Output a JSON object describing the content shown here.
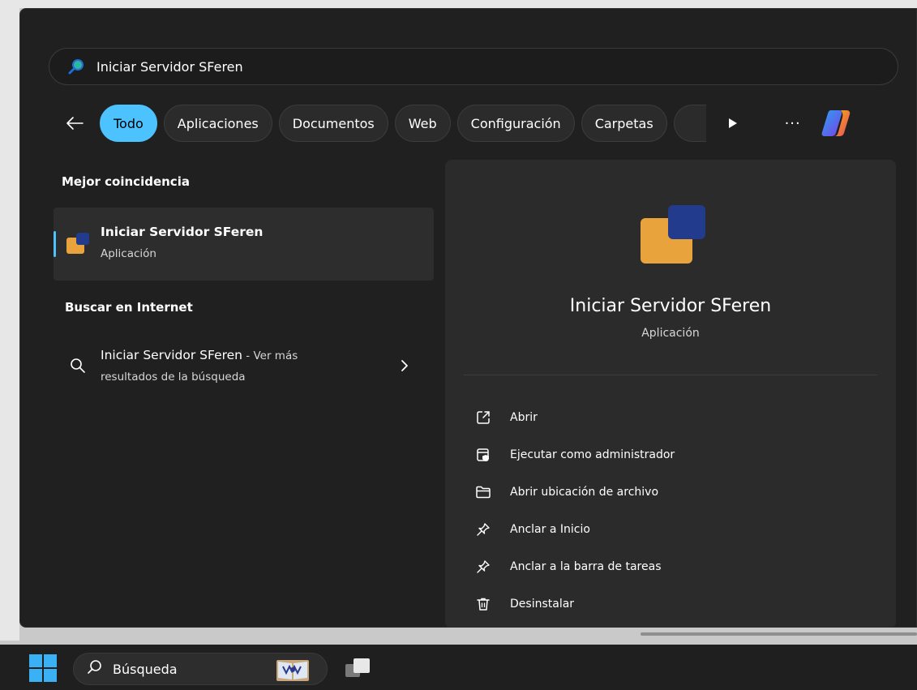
{
  "search": {
    "query": "Iniciar Servidor SFeren",
    "placeholder": ""
  },
  "filters": {
    "items": [
      {
        "label": "Todo",
        "active": true
      },
      {
        "label": "Aplicaciones",
        "active": false
      },
      {
        "label": "Documentos",
        "active": false
      },
      {
        "label": "Web",
        "active": false
      },
      {
        "label": "Configuración",
        "active": false
      },
      {
        "label": "Carpetas",
        "active": false
      }
    ],
    "more_label": "···"
  },
  "best_match": {
    "section_title": "Mejor coincidencia",
    "name": "Iniciar Servidor SFeren",
    "type": "Aplicación"
  },
  "web": {
    "section_title": "Buscar en Internet",
    "query": "Iniciar Servidor SFeren",
    "suffix": " - Ver más",
    "line2": "resultados de la búsqueda"
  },
  "preview": {
    "title": "Iniciar Servidor SFeren",
    "subtitle": "Aplicación",
    "actions": [
      {
        "label": "Abrir",
        "icon": "open-external-icon"
      },
      {
        "label": "Ejecutar como administrador",
        "icon": "run-as-admin-icon"
      },
      {
        "label": "Abrir ubicación de archivo",
        "icon": "folder-icon"
      },
      {
        "label": "Anclar a Inicio",
        "icon": "pin-icon"
      },
      {
        "label": "Anclar a la barra de tareas",
        "icon": "pin-icon"
      },
      {
        "label": "Desinstalar",
        "icon": "trash-icon"
      }
    ]
  },
  "taskbar": {
    "search_label": "Búsqueda"
  },
  "colors": {
    "accent": "#4cc2ff",
    "panel_bg": "#202020",
    "app_icon_orange": "#e8a33c",
    "app_icon_blue": "#233b8d"
  }
}
